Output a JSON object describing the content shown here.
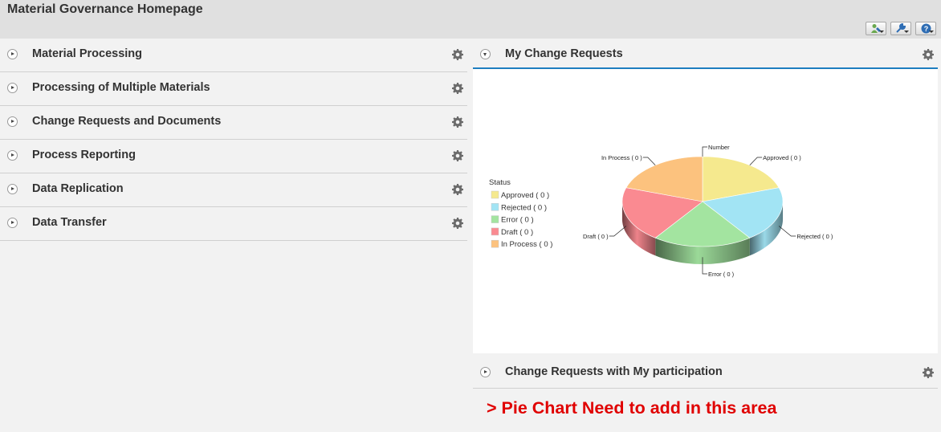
{
  "page": {
    "title": "Material Governance Homepage"
  },
  "toolbar": {
    "icons": [
      "personalize-icon",
      "settings-wrench-icon",
      "help-icon"
    ]
  },
  "left_panels": [
    {
      "title": "Material Processing"
    },
    {
      "title": "Processing of Multiple Materials"
    },
    {
      "title": "Change Requests and Documents"
    },
    {
      "title": "Process Reporting"
    },
    {
      "title": "Data Replication"
    },
    {
      "title": "Data Transfer"
    }
  ],
  "my_change_requests": {
    "title": "My Change Requests"
  },
  "change_requests_participation": {
    "title": "Change Requests with My participation"
  },
  "annotation": {
    "text": "> Pie Chart Need to add in this area"
  },
  "chart_data": {
    "type": "pie",
    "style": "3d",
    "series_label": "Number",
    "legend_title": "Status",
    "legend_position": "left",
    "categories": [
      "Approved",
      "Rejected",
      "Error",
      "Draft",
      "In Process"
    ],
    "values": [
      0,
      0,
      0,
      0,
      0
    ],
    "legend_labels": [
      "Approved ( 0 )",
      "Rejected ( 0 )",
      "Error ( 0 )",
      "Draft ( 0 )",
      "In Process ( 0 )"
    ],
    "slice_labels": [
      "Approved ( 0 )",
      "Rejected ( 0 )",
      "Error ( 0 )",
      "Draft ( 0 )",
      "In Process ( 0 )"
    ],
    "colors": [
      "#f5e98e",
      "#a2e4f4",
      "#a3e4a0",
      "#fa8a91",
      "#fcc27e"
    ]
  }
}
